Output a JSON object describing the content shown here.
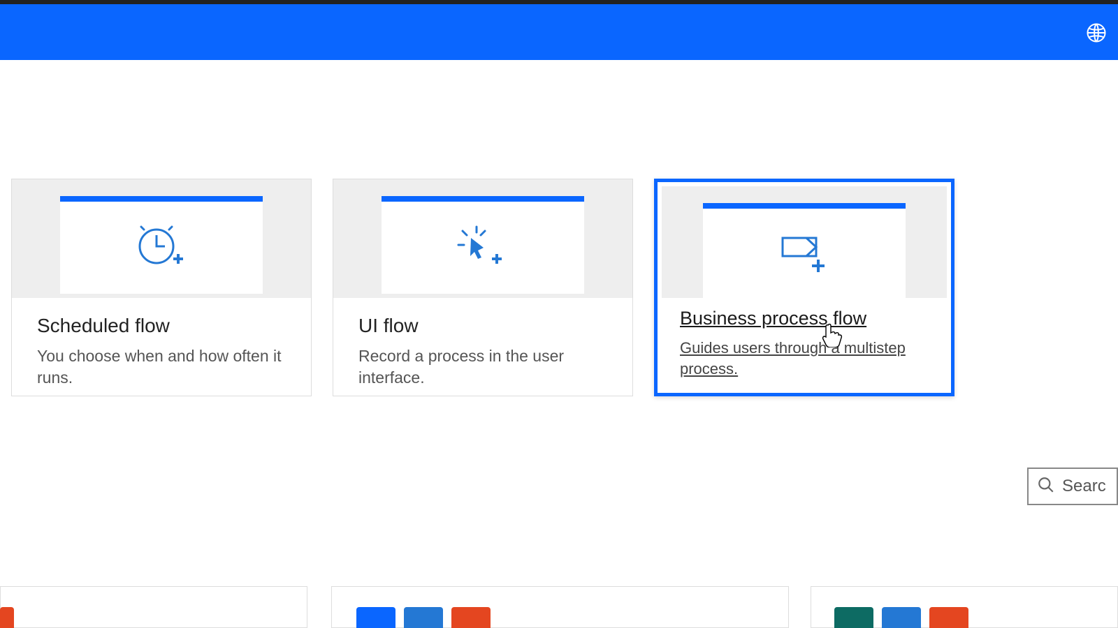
{
  "cards": [
    {
      "title": "Scheduled flow",
      "desc": "You choose when and how often it runs.",
      "icon": "clock"
    },
    {
      "title": "UI flow",
      "desc": "Record a process in the user interface.",
      "icon": "cursor"
    },
    {
      "title": "Business process flow",
      "desc": "Guides users through a multistep process.",
      "icon": "process"
    }
  ],
  "search": {
    "placeholder": "Searc"
  }
}
